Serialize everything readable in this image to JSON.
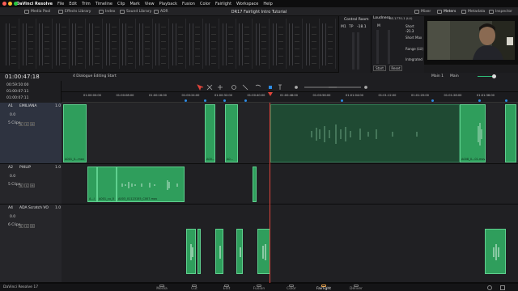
{
  "menubar": {
    "app": "DaVinci Resolve",
    "items": [
      "File",
      "Edit",
      "Trim",
      "Timeline",
      "Clip",
      "Mark",
      "View",
      "Playback",
      "Fusion",
      "Color",
      "Fairlight",
      "Workspace",
      "Help"
    ]
  },
  "toolbar": {
    "media_pool": "Media Pool",
    "effects_library": "Effects Library",
    "index": "Index",
    "sound_library": "Sound Library",
    "adr": "ADR",
    "project_title": "DR17 Fairlight Intro Tutorial",
    "mixer": "Mixer",
    "meters": "Meters",
    "metadata": "Metadata",
    "inspector": "Inspector"
  },
  "control_room": {
    "title": "Control Room",
    "tp_label": "TP",
    "tp_value": "-18.1",
    "m1": "M1",
    "m": "M"
  },
  "loudness": {
    "title": "Loudness",
    "standard": "BS.1770-1 (LU)",
    "short": "Short",
    "short_value": "-21.3",
    "short_max": "Short Max",
    "range": "Range (LU)",
    "integrated": "Integrated",
    "start": "Start",
    "reset": "Reset"
  },
  "timecode": {
    "main": "01:00:47:18",
    "rows": [
      "00:59:50:00",
      "01:00:07:11",
      "01:00:07:11"
    ],
    "timeline_name": "4 Dialogue Editing Start",
    "main_out": "Main 1",
    "main_in": "Main"
  },
  "ruler": {
    "ticks": [
      "01:00:00:00",
      "01:00:08:00",
      "01:00:16:00",
      "01:00:24:00",
      "01:00:32:00",
      "01:00:40:00",
      "01:00:48:00",
      "01:00:56:00",
      "01:01:04:00",
      "01:01:12:00",
      "01:01:20:00",
      "01:01:28:00",
      "01:01:36:00"
    ]
  },
  "tracks": [
    {
      "id": "A1",
      "name": "EMILIANA",
      "gain": "0.0",
      "clips_label": "5 Clips",
      "vol": "1.0",
      "clips": [
        "A001_0...mov",
        "A00...",
        "A0...",
        "A008_0...01.mov"
      ]
    },
    {
      "id": "A2",
      "name": "PHILIP",
      "gain": "0.0",
      "clips_label": "5 Clips",
      "vol": "1.0",
      "clips": [
        "A...l",
        "A001_cu_0",
        "A003_01123155_C007.mov"
      ]
    },
    {
      "id": "A4",
      "name": "ADA Scratch VO",
      "gain": "0.0",
      "clips_label": "6 Clips",
      "vol": "1.0",
      "clips": []
    }
  ],
  "pages": [
    "Media",
    "Cut",
    "Edit",
    "Fusion",
    "Color",
    "Fairlight",
    "Deliver"
  ],
  "active_page": "Fairlight",
  "product": "DaVinci Resolve 17",
  "colors": {
    "clip_green": "#2f9e5c",
    "playhead": "#e0453b",
    "marker_blue": "#2e8de6",
    "accent": "#e8a24a"
  }
}
